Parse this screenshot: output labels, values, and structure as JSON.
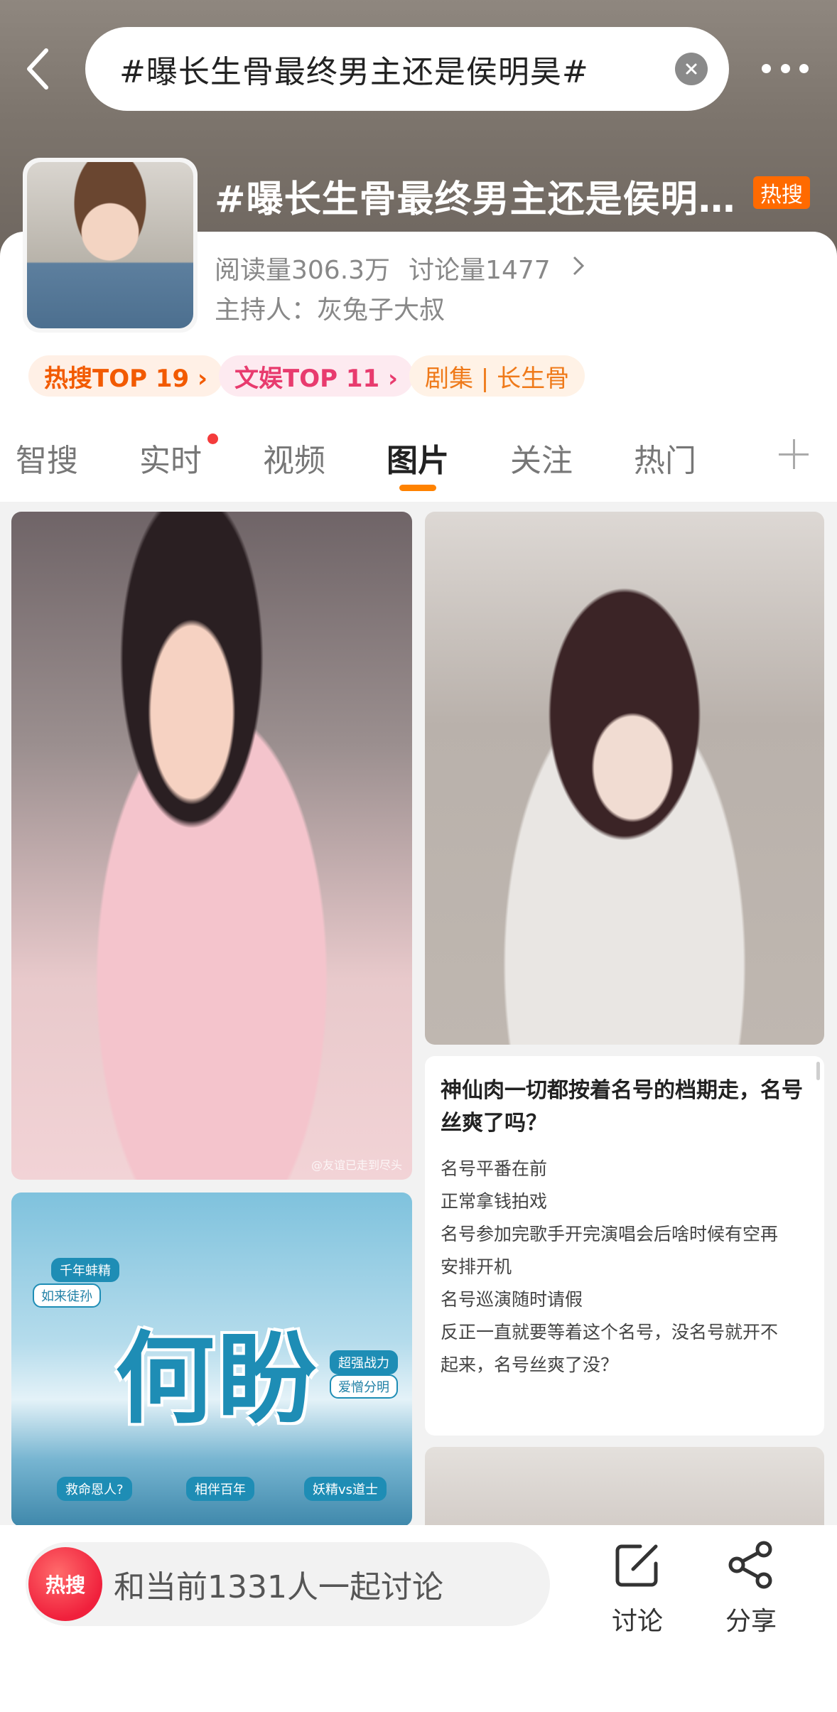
{
  "header": {
    "search_query": "#曝长生骨最终男主还是侯明昊#",
    "topic_title": "#曝长生骨最终男主还是侯明昊#",
    "hot_badge": "热搜",
    "read_count": "阅读量306.3万",
    "discuss_count": "讨论量1477",
    "host": "主持人：灰兔子大叔"
  },
  "tags": [
    {
      "label": "热搜TOP 19 ›"
    },
    {
      "label": "文娱TOP 11 ›"
    },
    {
      "label": "剧集 | 长生骨"
    }
  ],
  "tabs": [
    {
      "label": "智搜"
    },
    {
      "label": "实时"
    },
    {
      "label": "视频"
    },
    {
      "label": "图片"
    },
    {
      "label": "关注"
    },
    {
      "label": "热门"
    }
  ],
  "active_tab": "图片",
  "cards": {
    "image_1_watermark": "@友谊已走到尽头",
    "image_3": {
      "title": "何盼",
      "tags": [
        "千年蚌精",
        "如来徒孙",
        "超强战力",
        "爱憎分明",
        "救命恩人?",
        "相伴百年",
        "妖精vs道士"
      ]
    },
    "text_post": {
      "title": "神仙肉一切都按着名号的档期走，名号丝爽了吗？",
      "lines": [
        "名号平番在前",
        "正常拿钱拍戏",
        "名号参加完歌手开完演唱会后啥时候有空再",
        "安排开机",
        "名号巡演随时请假",
        "反正一直就要等着这个名号，没名号就开不",
        "起来，名号丝爽了没？"
      ]
    }
  },
  "bottom_bar": {
    "hot_logo": "热搜",
    "discuss_prompt": "和当前1331人一起讨论",
    "comment_label": "讨论",
    "share_label": "分享"
  },
  "colors": {
    "accent": "#ff8200",
    "hot_badge": "#ff6a00",
    "red_dot": "#f43b3b"
  }
}
